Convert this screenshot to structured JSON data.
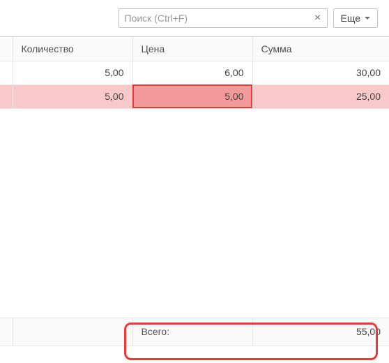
{
  "toolbar": {
    "search_placeholder": "Поиск (Ctrl+F)",
    "clear_icon": "×",
    "more_label": "Еще"
  },
  "columns": {
    "qty": "Количество",
    "price": "Цена",
    "sum": "Сумма"
  },
  "rows": [
    {
      "qty": "5,00",
      "price": "6,00",
      "sum": "30,00",
      "highlight": false
    },
    {
      "qty": "5,00",
      "price": "5,00",
      "sum": "25,00",
      "highlight": true
    }
  ],
  "footer": {
    "label": "Всего:",
    "total": "55,00"
  }
}
